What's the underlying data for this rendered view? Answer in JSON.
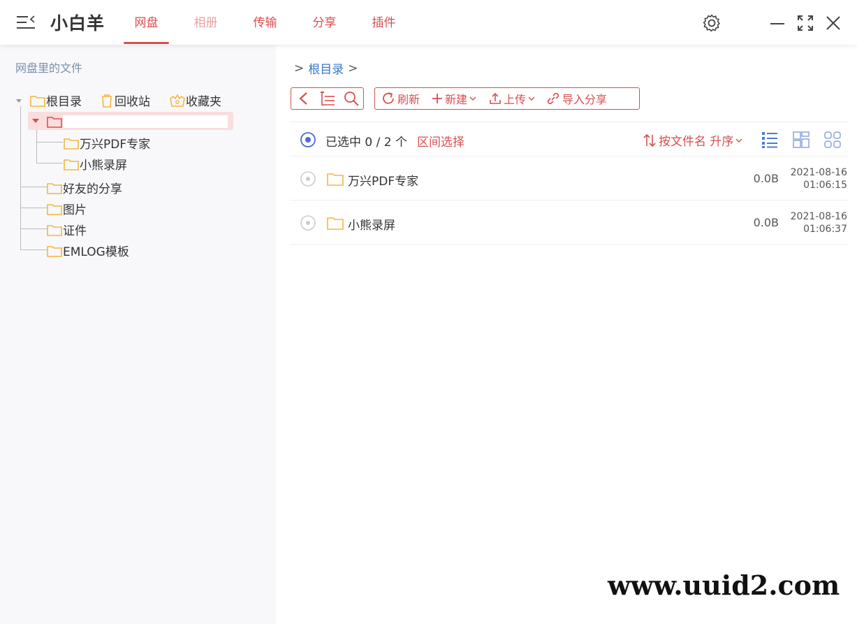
{
  "header": {
    "app_title": "小白羊",
    "tabs": [
      {
        "label": "网盘",
        "active": true
      },
      {
        "label": "相册",
        "active": false
      },
      {
        "label": "传输",
        "active": false
      },
      {
        "label": "分享",
        "active": false
      },
      {
        "label": "插件",
        "active": false
      }
    ]
  },
  "sidebar": {
    "heading": "网盘里的文件",
    "top_items": [
      {
        "label": "根目录",
        "icon": "folder-icon"
      },
      {
        "label": "回收站",
        "icon": "trash-icon"
      },
      {
        "label": "收藏夹",
        "icon": "favorites-icon"
      }
    ],
    "children": [
      {
        "label": "万兴PDF专家"
      },
      {
        "label": "小熊录屏"
      }
    ],
    "folders": [
      {
        "label": "好友的分享"
      },
      {
        "label": "图片"
      },
      {
        "label": "证件"
      },
      {
        "label": "EMLOG模板"
      }
    ]
  },
  "main": {
    "breadcrumb": {
      "prefix": ">",
      "root": "根目录",
      "suffix": ">"
    },
    "toolbar": {
      "refresh": "刷新",
      "new": "新建",
      "upload": "上传",
      "import_share": "导入分享"
    },
    "selection": {
      "text": "已选中 0 / 2 个",
      "range_select": "区间选择",
      "sort_label": "按文件名 升序"
    },
    "files": [
      {
        "name": "万兴PDF专家",
        "size": "0.0B",
        "date": "2021-08-16",
        "time": "01:06:15"
      },
      {
        "name": "小熊录屏",
        "size": "0.0B",
        "date": "2021-08-16",
        "time": "01:06:37"
      }
    ]
  },
  "watermark": "www.uuid2.com",
  "colors": {
    "accent": "#d84e4e",
    "folder": "#f5b53d",
    "link": "#3b78c2",
    "radio": "#4a6cd4"
  }
}
